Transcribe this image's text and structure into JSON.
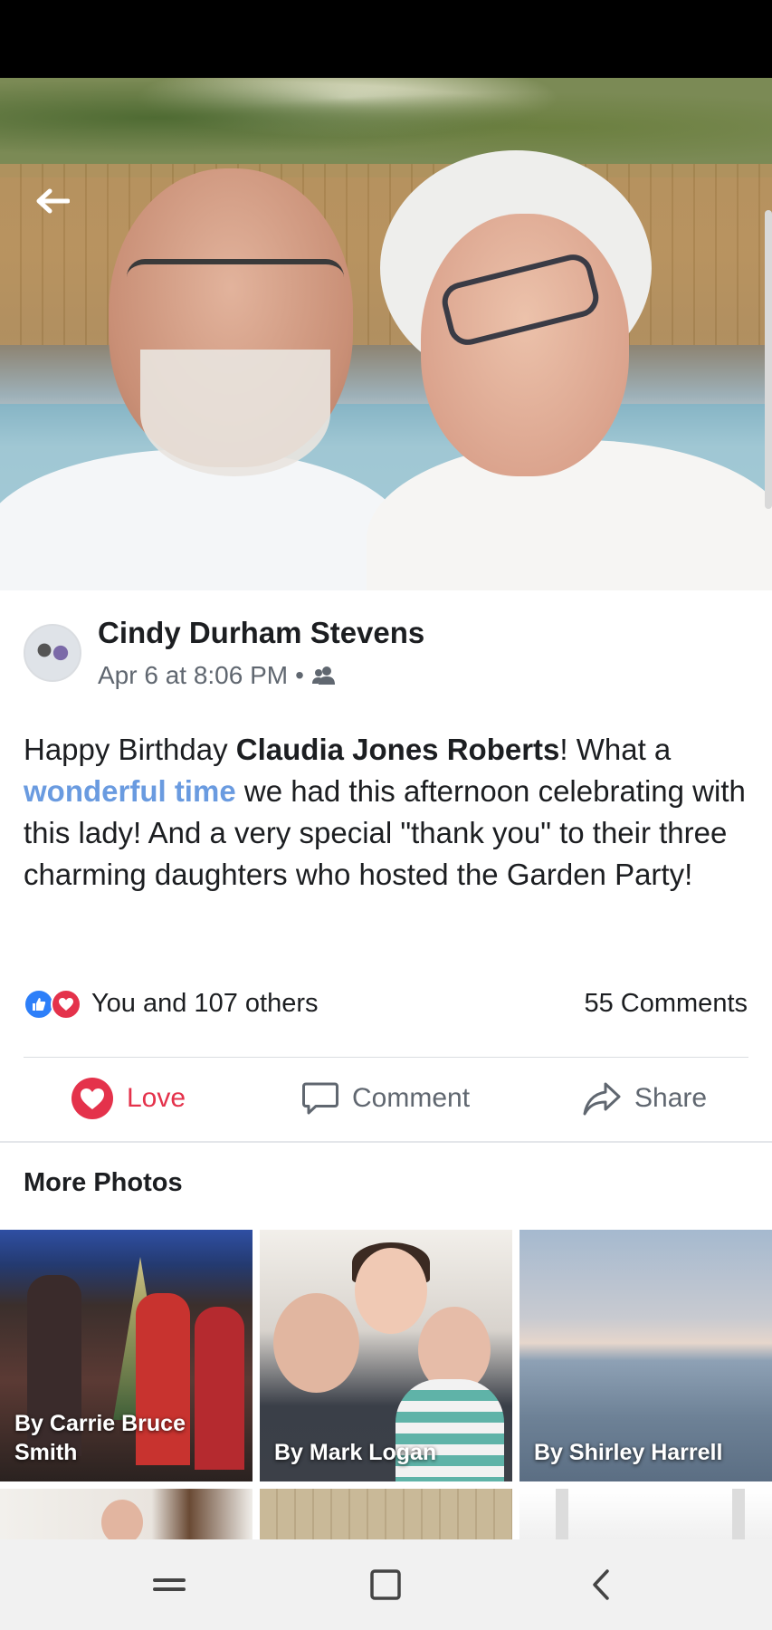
{
  "post": {
    "author": "Cindy Durham Stevens",
    "timestamp": "Apr 6 at 8:06 PM",
    "separator": "•",
    "audience_icon": "friends-icon",
    "text": {
      "part1": "Happy Birthday ",
      "tagged_name": "Claudia Jones Roberts",
      "part2": "!  What a ",
      "link": "wonderful time",
      "part3": " we had this afternoon celebrating with this lady!  And a very special \"thank you\" to their three charming daughters who hosted the Garden Party!"
    }
  },
  "reactions": {
    "summary": "You and 107 others",
    "comments": "55 Comments",
    "icons": [
      "like-icon",
      "love-icon"
    ],
    "like_color": "#2d7ff9",
    "love_color": "#e4324b"
  },
  "actions": {
    "love_label": "Love",
    "comment_label": "Comment",
    "share_label": "Share"
  },
  "more_photos": {
    "title": "More Photos",
    "photos": [
      {
        "caption": "By Carrie Bruce Smith"
      },
      {
        "caption": "By Mark Logan"
      },
      {
        "caption": "By Shirley Harrell"
      }
    ]
  },
  "nav": {
    "icons": [
      "recent-apps-icon",
      "home-icon",
      "back-icon"
    ]
  }
}
